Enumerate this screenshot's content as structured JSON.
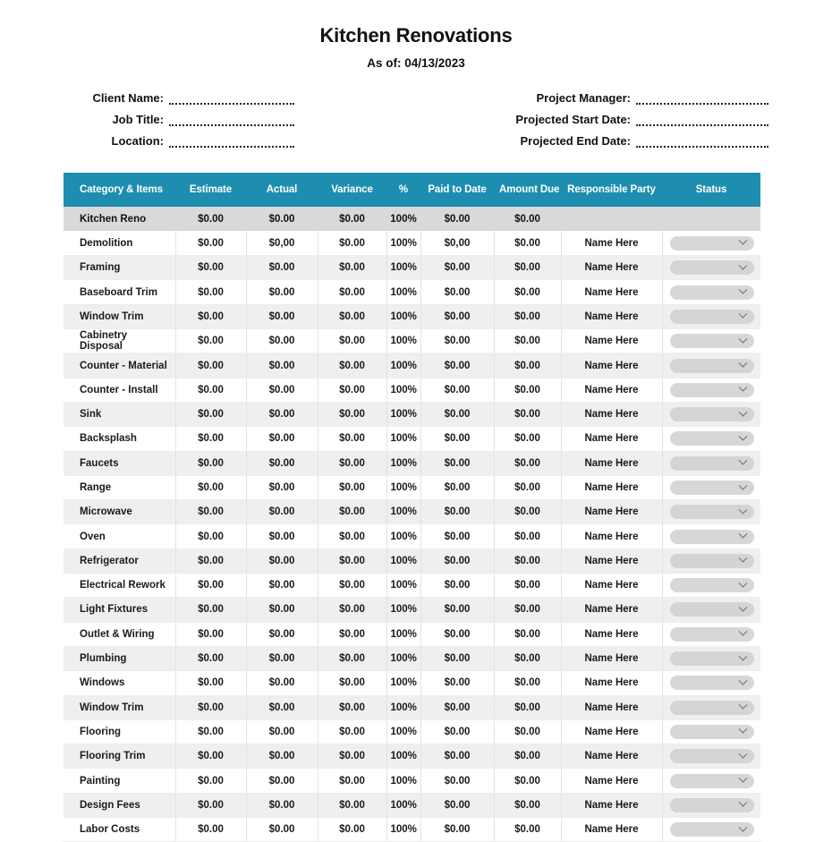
{
  "header": {
    "title": "Kitchen Renovations",
    "subtitle": "As of: 04/13/2023"
  },
  "meta": {
    "left": [
      {
        "label": "Client Name:",
        "value": ""
      },
      {
        "label": "Job Title:",
        "value": ""
      },
      {
        "label": "Location:",
        "value": ""
      }
    ],
    "right": [
      {
        "label": "Project Manager:",
        "value": ""
      },
      {
        "label": "Projected Start Date:",
        "value": ""
      },
      {
        "label": "Projected End Date:",
        "value": ""
      }
    ]
  },
  "table": {
    "accent_color": "#1D8EAF",
    "summary_row_color": "#D9D9D9",
    "stripe_color": "#EFEFEF",
    "columns": [
      "Category & Items",
      "Estimate",
      "Actual",
      "Variance",
      "%",
      "Paid to Date",
      "Amount Due",
      "Responsible Party",
      "Status"
    ],
    "summary": {
      "category": "Kitchen Reno",
      "estimate": "$0.00",
      "actual": "$0.00",
      "variance": "$0.00",
      "percent": "100%",
      "paid_to_date": "$0.00",
      "amount_due": "$0.00",
      "responsible_party": "",
      "status": ""
    },
    "status_icon": "chevron-down-icon",
    "rows": [
      {
        "category": "Demolition",
        "estimate": "$0.00",
        "actual": "$0,00",
        "variance": "$0.00",
        "percent": "100%",
        "paid_to_date": "$0,00",
        "amount_due": "$0.00",
        "responsible_party": "Name Here",
        "status": ""
      },
      {
        "category": "Framing",
        "estimate": "$0.00",
        "actual": "$0.00",
        "variance": "$0.00",
        "percent": "100%",
        "paid_to_date": "$0.00",
        "amount_due": "$0.00",
        "responsible_party": "Name Here",
        "status": ""
      },
      {
        "category": "Baseboard Trim",
        "estimate": "$0.00",
        "actual": "$0.00",
        "variance": "$0.00",
        "percent": "100%",
        "paid_to_date": "$0.00",
        "amount_due": "$0.00",
        "responsible_party": "Name Here",
        "status": ""
      },
      {
        "category": "Window Trim",
        "estimate": "$0.00",
        "actual": "$0.00",
        "variance": "$0.00",
        "percent": "100%",
        "paid_to_date": "$0.00",
        "amount_due": "$0.00",
        "responsible_party": "Name Here",
        "status": ""
      },
      {
        "category": "Cabinetry Disposal",
        "estimate": "$0.00",
        "actual": "$0.00",
        "variance": "$0.00",
        "percent": "100%",
        "paid_to_date": "$0.00",
        "amount_due": "$0.00",
        "responsible_party": "Name Here",
        "status": ""
      },
      {
        "category": "Counter - Material",
        "estimate": "$0.00",
        "actual": "$0.00",
        "variance": "$0.00",
        "percent": "100%",
        "paid_to_date": "$0.00",
        "amount_due": "$0.00",
        "responsible_party": "Name Here",
        "status": ""
      },
      {
        "category": "Counter - Install",
        "estimate": "$0.00",
        "actual": "$0.00",
        "variance": "$0.00",
        "percent": "100%",
        "paid_to_date": "$0.00",
        "amount_due": "$0.00",
        "responsible_party": "Name Here",
        "status": ""
      },
      {
        "category": "Sink",
        "estimate": "$0.00",
        "actual": "$0.00",
        "variance": "$0.00",
        "percent": "100%",
        "paid_to_date": "$0.00",
        "amount_due": "$0.00",
        "responsible_party": "Name Here",
        "status": ""
      },
      {
        "category": "Backsplash",
        "estimate": "$0.00",
        "actual": "$0.00",
        "variance": "$0.00",
        "percent": "100%",
        "paid_to_date": "$0.00",
        "amount_due": "$0.00",
        "responsible_party": "Name Here",
        "status": ""
      },
      {
        "category": "Faucets",
        "estimate": "$0.00",
        "actual": "$0.00",
        "variance": "$0.00",
        "percent": "100%",
        "paid_to_date": "$0.00",
        "amount_due": "$0.00",
        "responsible_party": "Name Here",
        "status": ""
      },
      {
        "category": "Range",
        "estimate": "$0.00",
        "actual": "$0.00",
        "variance": "$0.00",
        "percent": "100%",
        "paid_to_date": "$0.00",
        "amount_due": "$0.00",
        "responsible_party": "Name Here",
        "status": ""
      },
      {
        "category": "Microwave",
        "estimate": "$0.00",
        "actual": "$0.00",
        "variance": "$0.00",
        "percent": "100%",
        "paid_to_date": "$0.00",
        "amount_due": "$0.00",
        "responsible_party": "Name Here",
        "status": ""
      },
      {
        "category": "Oven",
        "estimate": "$0.00",
        "actual": "$0.00",
        "variance": "$0.00",
        "percent": "100%",
        "paid_to_date": "$0.00",
        "amount_due": "$0.00",
        "responsible_party": "Name Here",
        "status": ""
      },
      {
        "category": "Refrigerator",
        "estimate": "$0.00",
        "actual": "$0.00",
        "variance": "$0.00",
        "percent": "100%",
        "paid_to_date": "$0.00",
        "amount_due": "$0.00",
        "responsible_party": "Name Here",
        "status": ""
      },
      {
        "category": "Electrical Rework",
        "estimate": "$0.00",
        "actual": "$0.00",
        "variance": "$0.00",
        "percent": "100%",
        "paid_to_date": "$0.00",
        "amount_due": "$0.00",
        "responsible_party": "Name Here",
        "status": ""
      },
      {
        "category": "Light Fixtures",
        "estimate": "$0.00",
        "actual": "$0.00",
        "variance": "$0.00",
        "percent": "100%",
        "paid_to_date": "$0.00",
        "amount_due": "$0.00",
        "responsible_party": "Name Here",
        "status": ""
      },
      {
        "category": "Outlet & Wiring",
        "estimate": "$0.00",
        "actual": "$0.00",
        "variance": "$0.00",
        "percent": "100%",
        "paid_to_date": "$0.00",
        "amount_due": "$0.00",
        "responsible_party": "Name Here",
        "status": ""
      },
      {
        "category": "Plumbing",
        "estimate": "$0.00",
        "actual": "$0.00",
        "variance": "$0.00",
        "percent": "100%",
        "paid_to_date": "$0.00",
        "amount_due": "$0.00",
        "responsible_party": "Name Here",
        "status": ""
      },
      {
        "category": "Windows",
        "estimate": "$0.00",
        "actual": "$0.00",
        "variance": "$0.00",
        "percent": "100%",
        "paid_to_date": "$0.00",
        "amount_due": "$0.00",
        "responsible_party": "Name Here",
        "status": ""
      },
      {
        "category": "Window Trim",
        "estimate": "$0.00",
        "actual": "$0.00",
        "variance": "$0.00",
        "percent": "100%",
        "paid_to_date": "$0.00",
        "amount_due": "$0.00",
        "responsible_party": "Name Here",
        "status": ""
      },
      {
        "category": "Flooring",
        "estimate": "$0.00",
        "actual": "$0.00",
        "variance": "$0.00",
        "percent": "100%",
        "paid_to_date": "$0.00",
        "amount_due": "$0.00",
        "responsible_party": "Name Here",
        "status": ""
      },
      {
        "category": "Flooring Trim",
        "estimate": "$0.00",
        "actual": "$0.00",
        "variance": "$0.00",
        "percent": "100%",
        "paid_to_date": "$0.00",
        "amount_due": "$0.00",
        "responsible_party": "Name Here",
        "status": ""
      },
      {
        "category": "Painting",
        "estimate": "$0.00",
        "actual": "$0.00",
        "variance": "$0.00",
        "percent": "100%",
        "paid_to_date": "$0.00",
        "amount_due": "$0.00",
        "responsible_party": "Name Here",
        "status": ""
      },
      {
        "category": "Design Fees",
        "estimate": "$0.00",
        "actual": "$0.00",
        "variance": "$0.00",
        "percent": "100%",
        "paid_to_date": "$0.00",
        "amount_due": "$0.00",
        "responsible_party": "Name Here",
        "status": ""
      },
      {
        "category": "Labor Costs",
        "estimate": "$0.00",
        "actual": "$0.00",
        "variance": "$0.00",
        "percent": "100%",
        "paid_to_date": "$0.00",
        "amount_due": "$0.00",
        "responsible_party": "Name Here",
        "status": ""
      }
    ]
  }
}
